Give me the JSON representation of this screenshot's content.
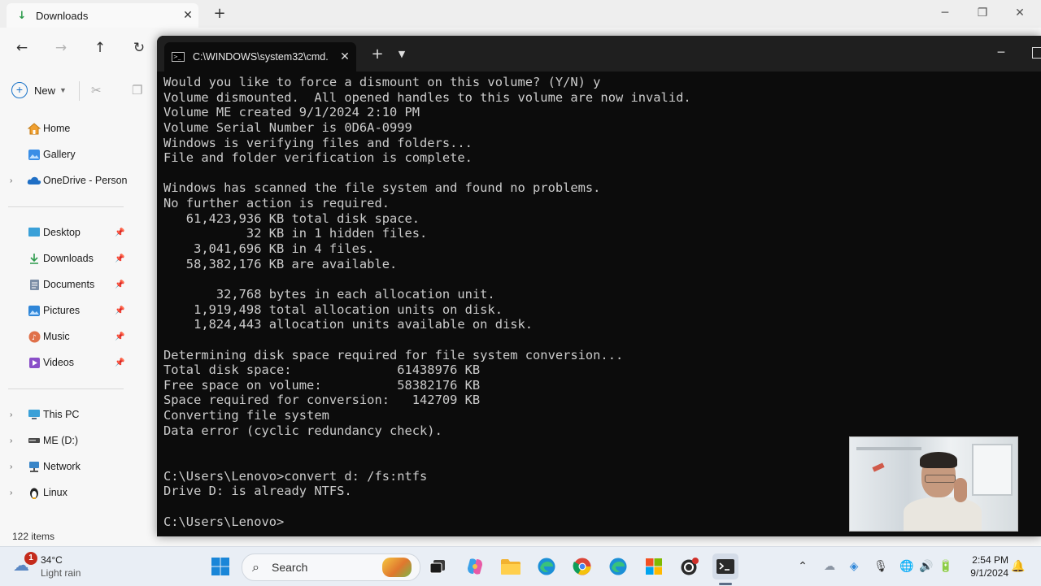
{
  "explorer": {
    "tab_title": "Downloads",
    "new_label": "New",
    "status": "122 items",
    "sidebar": {
      "home": "Home",
      "gallery": "Gallery",
      "onedrive": "OneDrive - Persona",
      "desktop": "Desktop",
      "downloads": "Downloads",
      "documents": "Documents",
      "pictures": "Pictures",
      "music": "Music",
      "videos": "Videos",
      "this_pc": "This PC",
      "me_drive": "ME (D:)",
      "network": "Network",
      "linux": "Linux"
    }
  },
  "terminal": {
    "tab_title": "C:\\WINDOWS\\system32\\cmd.",
    "lines": [
      "Would you like to force a dismount on this volume? (Y/N) y",
      "Volume dismounted.  All opened handles to this volume are now invalid.",
      "Volume ME created 9/1/2024 2:10 PM",
      "Volume Serial Number is 0D6A-0999",
      "Windows is verifying files and folders...",
      "File and folder verification is complete.",
      "",
      "Windows has scanned the file system and found no problems.",
      "No further action is required.",
      "   61,423,936 KB total disk space.",
      "           32 KB in 1 hidden files.",
      "    3,041,696 KB in 4 files.",
      "   58,382,176 KB are available.",
      "",
      "       32,768 bytes in each allocation unit.",
      "    1,919,498 total allocation units on disk.",
      "    1,824,443 allocation units available on disk.",
      "",
      "Determining disk space required for file system conversion...",
      "Total disk space:              61438976 KB",
      "Free space on volume:          58382176 KB",
      "Space required for conversion:   142709 KB",
      "Converting file system",
      "Data error (cyclic redundancy check).",
      "",
      "",
      "C:\\Users\\Lenovo>convert d: /fs:ntfs",
      "Drive D: is already NTFS.",
      "",
      "C:\\Users\\Lenovo>"
    ]
  },
  "taskbar": {
    "weather_badge": "1",
    "temperature": "34°C",
    "condition": "Light rain",
    "search_label": "Search",
    "time": "2:54 PM",
    "date": "9/1/2024"
  }
}
